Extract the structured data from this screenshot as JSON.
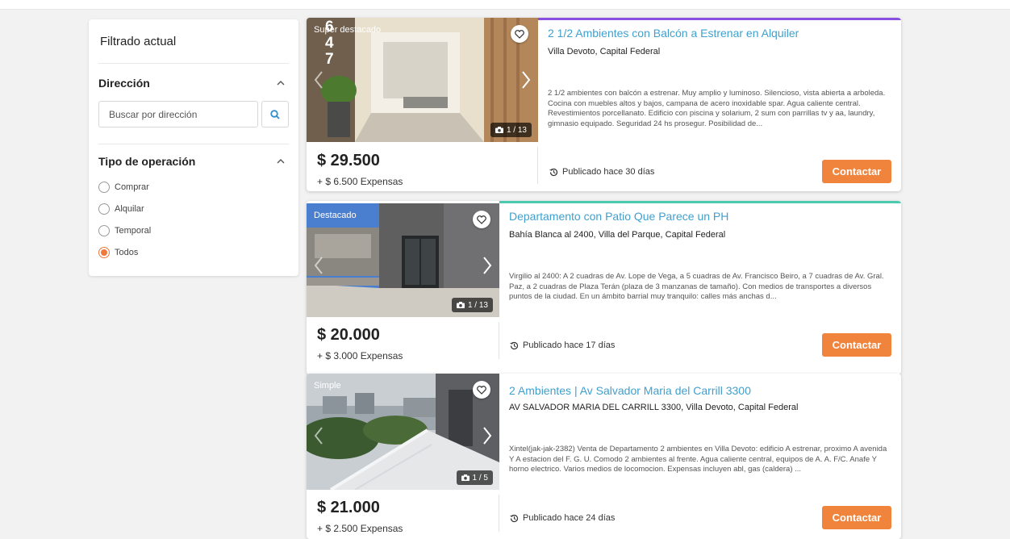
{
  "sidebar": {
    "title": "Filtrado actual",
    "direccion": {
      "label": "Dirección",
      "placeholder": "Buscar por dirección"
    },
    "operacion": {
      "label": "Tipo de operación",
      "options": [
        "Comprar",
        "Alquilar",
        "Temporal",
        "Todos"
      ],
      "selected": "Todos"
    }
  },
  "listings": [
    {
      "badge": "Super destacado",
      "photo_counter": "1 / 13",
      "title": "2 1/2 Ambientes con Balcón a Estrenar en Alquiler",
      "address": "Villa Devoto, Capital Federal",
      "description": "2 1/2 ambientes con balcón a estrenar. Muy amplio y luminoso. Silencioso, vista abierta a arboleda. Cocina con muebles altos y bajos, campana de acero inoxidable spar. Agua caliente central. Revestimientos porcellanato. Edificio con piscina y solarium, 2 sum con parrillas tv y aa, laundry, gimnasio equipado. Seguridad 24 hs prosegur. Posibilidad de...",
      "price": "$ 29.500",
      "expensas": "+ $ 6.500 Expensas",
      "published": "Publicado hace 30 días",
      "contact_label": "Contactar",
      "accent": "#8a4fe0",
      "building_number": [
        "6",
        "4",
        "7"
      ]
    },
    {
      "badge": "Destacado",
      "photo_counter": "1 / 13",
      "title": "Departamento con Patio Que Parece un PH",
      "address": "Bahía Blanca al 2400, Villa del Parque, Capital Federal",
      "description": "Virgilio al 2400: A 2 cuadras de Av. Lope de Vega, a 5 cuadras de Av. Francisco Beiro, a 7 cuadras de Av. Gral. Paz, a 2 cuadras de Plaza Terán (plaza de 3 manzanas de tamaño). Con medios de transportes a diversos puntos de la ciudad. En un ámbito barrial muy tranquilo: calles más anchas d...",
      "price": "$ 20.000",
      "expensas": "+ $ 3.000 Expensas",
      "published": "Publicado hace 17 días",
      "contact_label": "Contactar",
      "accent": "#4ccab0"
    },
    {
      "badge": "Simple",
      "photo_counter": "1 / 5",
      "title": "2 Ambientes | Av Salvador Maria del Carrill 3300",
      "address": "AV SALVADOR MARIA DEL CARRILL 3300, Villa Devoto, Capital Federal",
      "description": "Xintel(jak-jak-2382) Venta de Departamento 2 ambientes en Villa Devoto: edificio A estrenar, proximo A avenida Y A estacion del F. G. U. Comodo 2 ambientes al frente. Agua caliente central, equipos de A. A. F/C. Anafe Y horno electrico. Varios medios de locomocion. Expensas incluyen abl, gas (caldera) ...",
      "price": "$ 21.000",
      "expensas": "+ $ 2.500 Expensas",
      "published": "Publicado hace 24 días",
      "contact_label": "Contactar",
      "accent": "#ffffff"
    }
  ]
}
